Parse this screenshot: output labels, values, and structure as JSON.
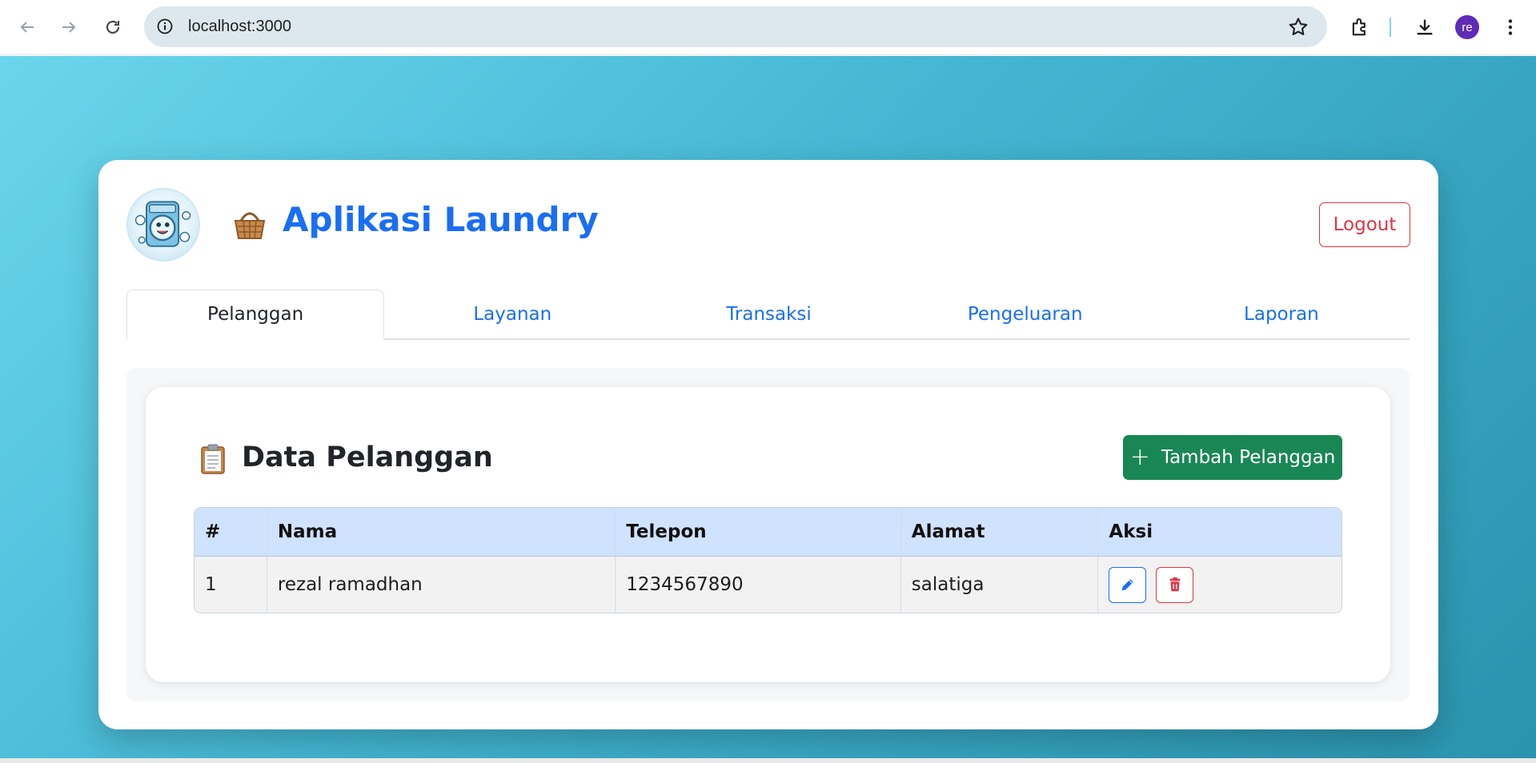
{
  "browser": {
    "url": "localhost:3000",
    "profile_initials": "re",
    "icons": [
      "back-arrow-icon",
      "forward-arrow-icon",
      "reload-icon",
      "site-info-icon",
      "bookmark-star-icon",
      "extensions-icon",
      "download-icon",
      "more-vert-icon"
    ]
  },
  "header": {
    "app_title": "Aplikasi Laundry",
    "logout_label": "Logout",
    "title_icon": "basket-icon",
    "logo_icon": "washing-machine-mascot-icon"
  },
  "tabs": [
    {
      "label": "Pelanggan",
      "active": true
    },
    {
      "label": "Layanan",
      "active": false
    },
    {
      "label": "Transaksi",
      "active": false
    },
    {
      "label": "Pengeluaran",
      "active": false
    },
    {
      "label": "Laporan",
      "active": false
    }
  ],
  "section": {
    "title": "Data Pelanggan",
    "title_icon": "clipboard-icon",
    "add_button_label": "Tambah Pelanggan"
  },
  "table": {
    "headers": [
      "#",
      "Nama",
      "Telepon",
      "Alamat",
      "Aksi"
    ],
    "rows": [
      {
        "no": "1",
        "nama": "rezal ramadhan",
        "telepon": "1234567890",
        "alamat": "salatiga",
        "actions": [
          "edit-icon",
          "delete-icon"
        ]
      }
    ]
  },
  "colors": {
    "primary": "#1a6ef5",
    "danger": "#dc3545",
    "success": "#198754",
    "table_header_bg": "#cfe2ff",
    "page_gradient_start": "#6ad6ec",
    "page_gradient_end": "#2a93ae"
  }
}
